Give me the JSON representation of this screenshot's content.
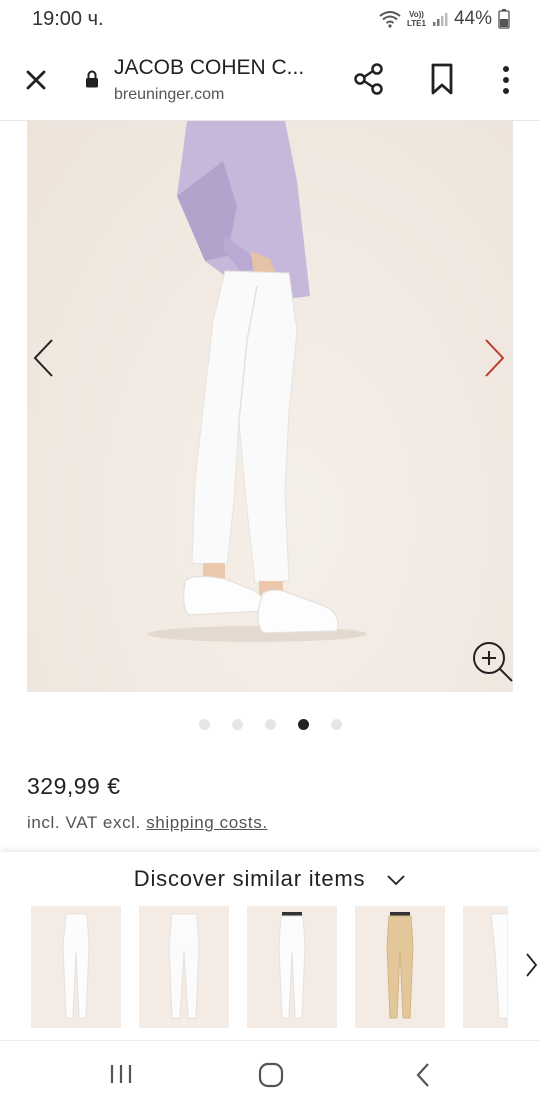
{
  "status_bar": {
    "time": "19:00 ч.",
    "network_top": "Vo))",
    "network_bottom": "LTE1",
    "battery": "44%"
  },
  "toolbar": {
    "page_title": "JACOB COHEN C...",
    "url": "breuninger.com"
  },
  "gallery": {
    "image_count": 5,
    "active_index": 3
  },
  "product": {
    "price": "329,99 €",
    "vat_text": "incl. VAT excl.",
    "shipping_link": "shipping costs."
  },
  "similar": {
    "header": "Discover similar items",
    "items": [
      {
        "color": "white"
      },
      {
        "color": "white"
      },
      {
        "color": "white"
      },
      {
        "color": "beige"
      },
      {
        "color": "white"
      }
    ]
  },
  "colors": {
    "accent_arrow": "#c0392b",
    "beige_pants": "#e2c79a"
  }
}
